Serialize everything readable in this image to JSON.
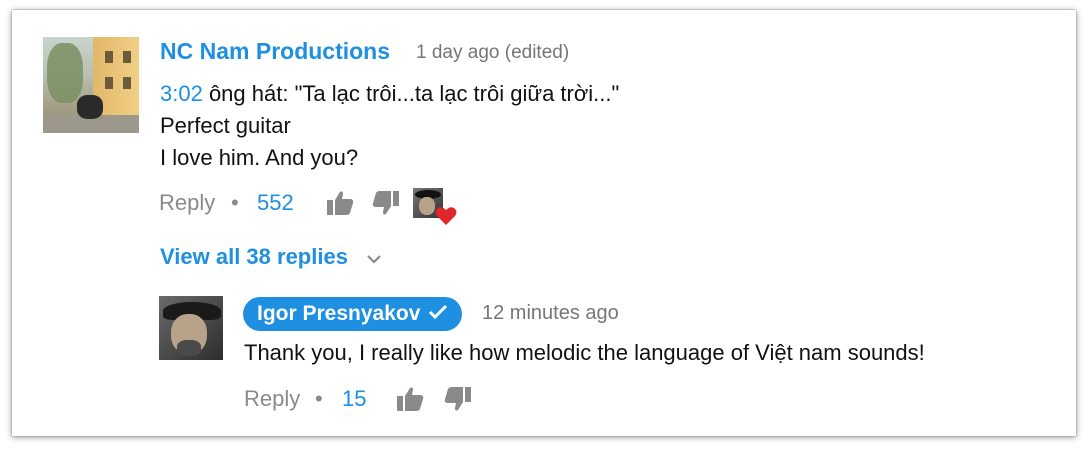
{
  "comment": {
    "author": "NC Nam Productions",
    "time": "1 day ago (edited)",
    "timestamp_link": "3:02",
    "line1_rest": " ông hát: \"Ta lạc trôi...ta lạc trôi giữa trời...\"",
    "line2": "Perfect guitar",
    "line3": "I love him. And you?",
    "reply_label": "Reply",
    "separator": "•",
    "like_count": "552",
    "heart_icon": "heart-icon"
  },
  "view_replies": "View all 38 replies",
  "reply": {
    "author": "Igor Presnyakov",
    "verified_icon": "check-icon",
    "time": "12 minutes ago",
    "text": "Thank you, I really like how melodic the language of Việt nam sounds!",
    "reply_label": "Reply",
    "separator": "•",
    "like_count": "15"
  },
  "colors": {
    "link_blue": "#1e8fe1",
    "muted_gray": "#8a8a8a",
    "heart_red": "#e0262b"
  }
}
